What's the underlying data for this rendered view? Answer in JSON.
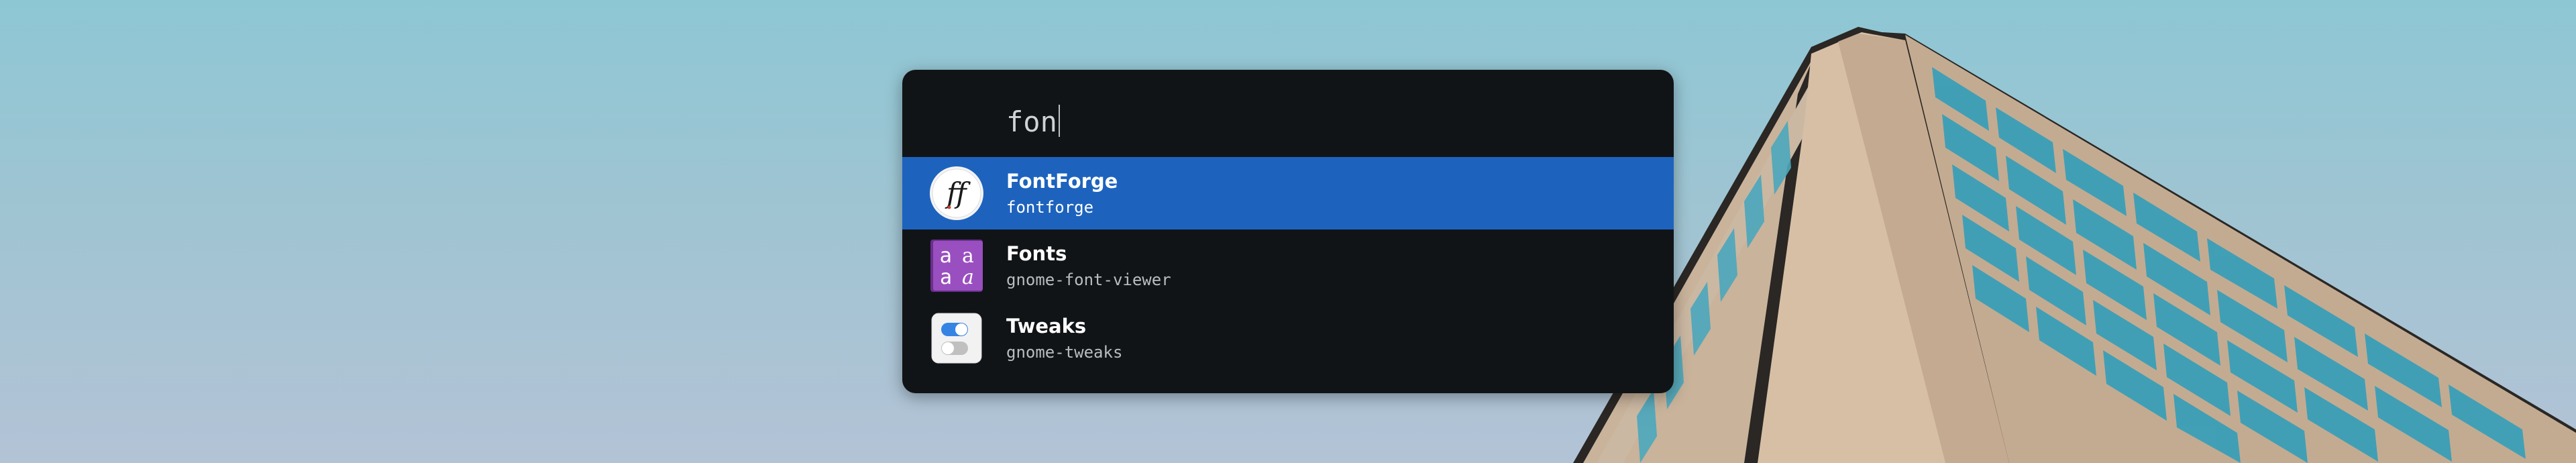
{
  "search": {
    "query": "fon"
  },
  "results": [
    {
      "name": "FontForge",
      "exec": "fontforge",
      "icon": "fontforge-icon",
      "selected": true
    },
    {
      "name": "Fonts",
      "exec": "gnome-font-viewer",
      "icon": "font-viewer-icon",
      "selected": false
    },
    {
      "name": "Tweaks",
      "exec": "gnome-tweaks",
      "icon": "tweaks-icon",
      "selected": false
    }
  ],
  "icon_glyphs": {
    "fontforge": "ff",
    "fonts": "a"
  },
  "colors": {
    "panel": "#111417",
    "selection": "#1d63be",
    "text": "#ffffff",
    "subtext": "#b9bcc0"
  }
}
